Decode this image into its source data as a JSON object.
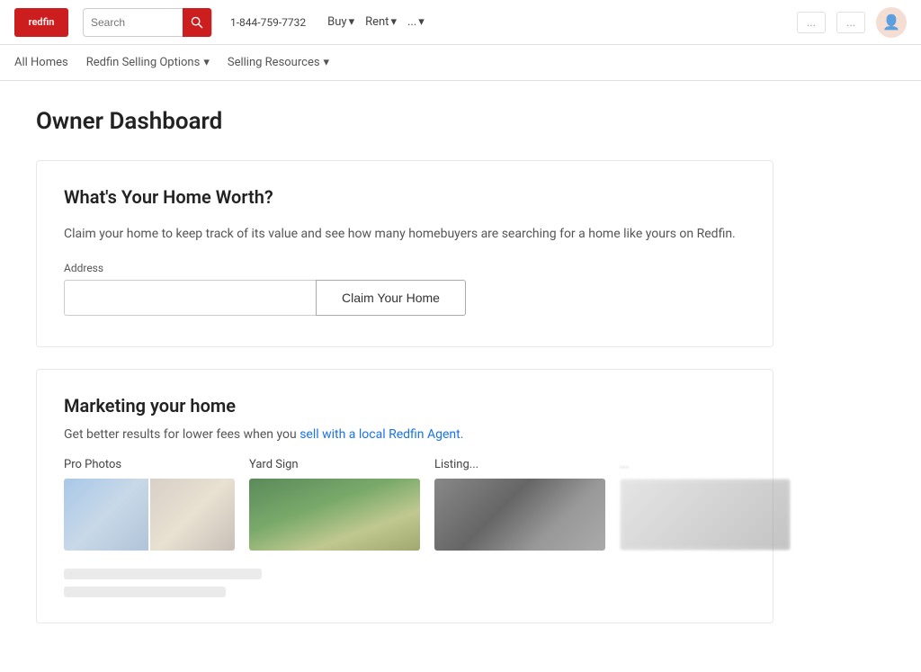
{
  "topnav": {
    "logo_text": "redfin",
    "phone": "1-844-759-7732",
    "nav_items": [
      {
        "label": "Buy",
        "has_arrow": true
      },
      {
        "label": "Rent",
        "has_arrow": true
      },
      {
        "label": "...",
        "has_arrow": true
      }
    ],
    "search_placeholder": "Search",
    "btn_label_1": "...",
    "btn_label_2": "..."
  },
  "subnav": {
    "item1": "All Homes",
    "item2_label": "Redfin Selling Options",
    "item3_label": "Selling Resources",
    "item2_arrow": "▾",
    "item3_arrow": "▾"
  },
  "main": {
    "page_title": "Owner Dashboard",
    "section_claim": {
      "heading": "What's Your Home Worth?",
      "description": "Claim your home to keep track of its value and see how many homebuyers are searching for a home like yours on Redfin.",
      "address_label": "Address",
      "address_placeholder": "",
      "claim_button_label": "Claim Your Home"
    },
    "section_marketing": {
      "heading": "Marketing your home",
      "description_prefix": "Get better results for lower fees when you ",
      "link_text": "sell with a local Redfin Agent.",
      "items": [
        {
          "label": "Pro Photos",
          "img_type": "pro-photos"
        },
        {
          "label": "Yard Sign",
          "img_type": "yard-sign"
        },
        {
          "label": "Listing...",
          "img_type": "listing"
        },
        {
          "label": "...",
          "img_type": "blurred"
        }
      ]
    }
  }
}
